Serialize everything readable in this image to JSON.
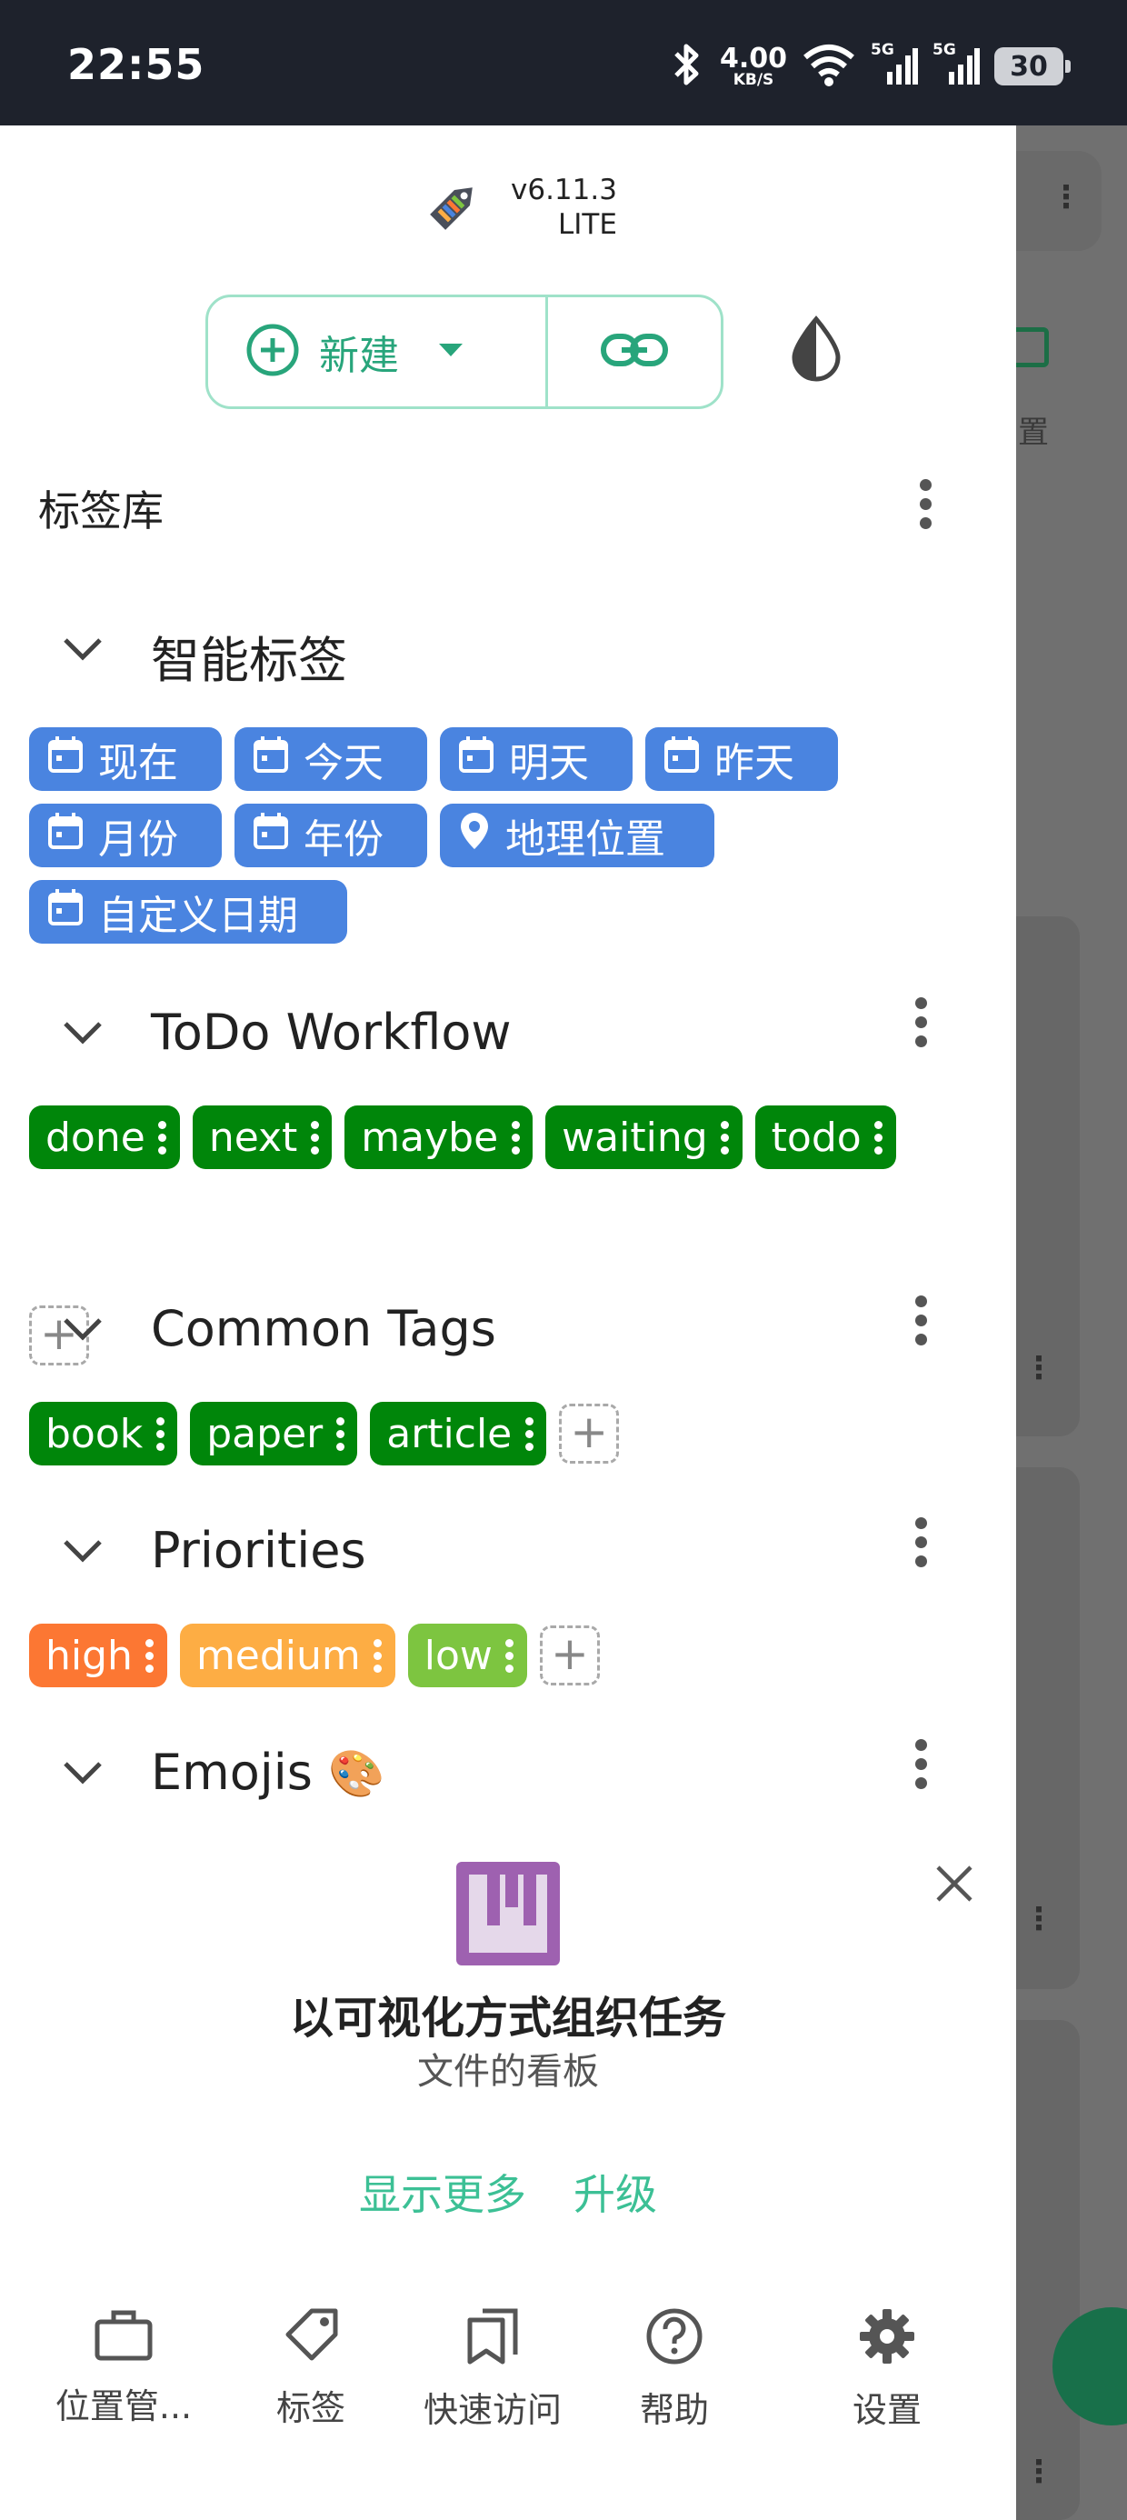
{
  "status_bar": {
    "time": "22:55",
    "network_speed": "4.00",
    "network_speed_unit": "KB/S",
    "signal_1": "5G",
    "signal_2": "5G",
    "battery": "30"
  },
  "drawer": {
    "version": "v6.11.3",
    "edition": "LITE",
    "new_button_label": "新建",
    "library_title": "标签库",
    "groups": {
      "smart": {
        "title": "智能标签",
        "tags": [
          "现在",
          "今天",
          "明天",
          "昨天",
          "月份",
          "年份",
          "地理位置",
          "自定义日期"
        ]
      },
      "todo": {
        "title": "ToDo Workflow",
        "tags": [
          "done",
          "next",
          "maybe",
          "waiting",
          "todo"
        ]
      },
      "common": {
        "title": "Common Tags",
        "tags": [
          "book",
          "paper",
          "article"
        ]
      },
      "priorities": {
        "title": "Priorities",
        "tags": [
          "high",
          "medium",
          "low"
        ]
      },
      "emojis": {
        "title": "Emojis",
        "emoji": "🎨"
      }
    },
    "promo": {
      "title": "以可视化方式组织任务",
      "subtitle": "文件的看板",
      "show_more": "显示更多",
      "upgrade": "升级"
    },
    "bottom_nav": [
      "位置管...",
      "标签",
      "快速访问",
      "帮助",
      "设置"
    ]
  },
  "background": {
    "partial_label": "置"
  },
  "colors": {
    "accent": "#28a57b",
    "smart_tag": "#4a84e0",
    "workflow_tag": "#00860a",
    "priority_high": "#fc7733",
    "priority_medium": "#fdad44",
    "priority_low": "#7dc540",
    "promo_logo": "#9e61b0"
  },
  "icons": {
    "app": "tag-logo-icon",
    "new": "plus-circle-icon",
    "dropdown": "caret-down-icon",
    "link": "link-icon",
    "theme": "contrast-drop-icon",
    "smart_date": "calendar-icon",
    "smart_geo": "location-pin-icon",
    "collapse": "chevron-down-icon",
    "more": "more-vertical-icon",
    "add": "plus-icon",
    "close": "close-icon",
    "nav": [
      "briefcase-icon",
      "tag-icon",
      "bookmarks-icon",
      "help-circle-icon",
      "gear-icon"
    ]
  }
}
